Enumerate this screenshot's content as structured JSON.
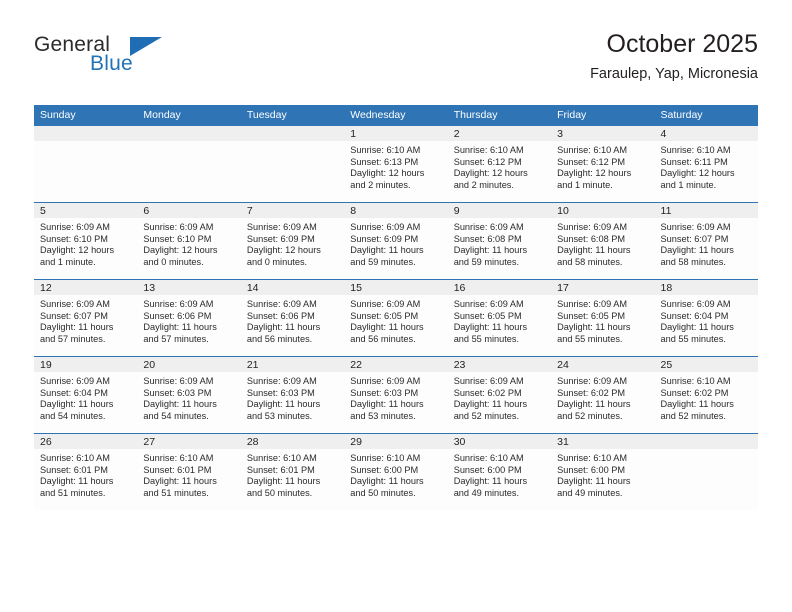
{
  "brand": {
    "line1": "General",
    "line2": "Blue",
    "triangle_color": "#1f6db5",
    "text_color": "#2b2b2b",
    "blue_color": "#2273b8"
  },
  "header": {
    "title": "October 2025",
    "subtitle": "Faraulep, Yap, Micronesia"
  },
  "theme": {
    "header_blue": "#2f74b5",
    "daynum_strip": "#efefef",
    "grid_line": "#2f74b5",
    "text": "#231f20"
  },
  "weekdays": [
    "Sunday",
    "Monday",
    "Tuesday",
    "Wednesday",
    "Thursday",
    "Friday",
    "Saturday"
  ],
  "weeks": [
    [
      {
        "day": "",
        "lines": []
      },
      {
        "day": "",
        "lines": []
      },
      {
        "day": "",
        "lines": []
      },
      {
        "day": "1",
        "lines": [
          "Sunrise: 6:10 AM",
          "Sunset: 6:13 PM",
          "Daylight: 12 hours",
          "and 2 minutes."
        ]
      },
      {
        "day": "2",
        "lines": [
          "Sunrise: 6:10 AM",
          "Sunset: 6:12 PM",
          "Daylight: 12 hours",
          "and 2 minutes."
        ]
      },
      {
        "day": "3",
        "lines": [
          "Sunrise: 6:10 AM",
          "Sunset: 6:12 PM",
          "Daylight: 12 hours",
          "and 1 minute."
        ]
      },
      {
        "day": "4",
        "lines": [
          "Sunrise: 6:10 AM",
          "Sunset: 6:11 PM",
          "Daylight: 12 hours",
          "and 1 minute."
        ]
      }
    ],
    [
      {
        "day": "5",
        "lines": [
          "Sunrise: 6:09 AM",
          "Sunset: 6:10 PM",
          "Daylight: 12 hours",
          "and 1 minute."
        ]
      },
      {
        "day": "6",
        "lines": [
          "Sunrise: 6:09 AM",
          "Sunset: 6:10 PM",
          "Daylight: 12 hours",
          "and 0 minutes."
        ]
      },
      {
        "day": "7",
        "lines": [
          "Sunrise: 6:09 AM",
          "Sunset: 6:09 PM",
          "Daylight: 12 hours",
          "and 0 minutes."
        ]
      },
      {
        "day": "8",
        "lines": [
          "Sunrise: 6:09 AM",
          "Sunset: 6:09 PM",
          "Daylight: 11 hours",
          "and 59 minutes."
        ]
      },
      {
        "day": "9",
        "lines": [
          "Sunrise: 6:09 AM",
          "Sunset: 6:08 PM",
          "Daylight: 11 hours",
          "and 59 minutes."
        ]
      },
      {
        "day": "10",
        "lines": [
          "Sunrise: 6:09 AM",
          "Sunset: 6:08 PM",
          "Daylight: 11 hours",
          "and 58 minutes."
        ]
      },
      {
        "day": "11",
        "lines": [
          "Sunrise: 6:09 AM",
          "Sunset: 6:07 PM",
          "Daylight: 11 hours",
          "and 58 minutes."
        ]
      }
    ],
    [
      {
        "day": "12",
        "lines": [
          "Sunrise: 6:09 AM",
          "Sunset: 6:07 PM",
          "Daylight: 11 hours",
          "and 57 minutes."
        ]
      },
      {
        "day": "13",
        "lines": [
          "Sunrise: 6:09 AM",
          "Sunset: 6:06 PM",
          "Daylight: 11 hours",
          "and 57 minutes."
        ]
      },
      {
        "day": "14",
        "lines": [
          "Sunrise: 6:09 AM",
          "Sunset: 6:06 PM",
          "Daylight: 11 hours",
          "and 56 minutes."
        ]
      },
      {
        "day": "15",
        "lines": [
          "Sunrise: 6:09 AM",
          "Sunset: 6:05 PM",
          "Daylight: 11 hours",
          "and 56 minutes."
        ]
      },
      {
        "day": "16",
        "lines": [
          "Sunrise: 6:09 AM",
          "Sunset: 6:05 PM",
          "Daylight: 11 hours",
          "and 55 minutes."
        ]
      },
      {
        "day": "17",
        "lines": [
          "Sunrise: 6:09 AM",
          "Sunset: 6:05 PM",
          "Daylight: 11 hours",
          "and 55 minutes."
        ]
      },
      {
        "day": "18",
        "lines": [
          "Sunrise: 6:09 AM",
          "Sunset: 6:04 PM",
          "Daylight: 11 hours",
          "and 55 minutes."
        ]
      }
    ],
    [
      {
        "day": "19",
        "lines": [
          "Sunrise: 6:09 AM",
          "Sunset: 6:04 PM",
          "Daylight: 11 hours",
          "and 54 minutes."
        ]
      },
      {
        "day": "20",
        "lines": [
          "Sunrise: 6:09 AM",
          "Sunset: 6:03 PM",
          "Daylight: 11 hours",
          "and 54 minutes."
        ]
      },
      {
        "day": "21",
        "lines": [
          "Sunrise: 6:09 AM",
          "Sunset: 6:03 PM",
          "Daylight: 11 hours",
          "and 53 minutes."
        ]
      },
      {
        "day": "22",
        "lines": [
          "Sunrise: 6:09 AM",
          "Sunset: 6:03 PM",
          "Daylight: 11 hours",
          "and 53 minutes."
        ]
      },
      {
        "day": "23",
        "lines": [
          "Sunrise: 6:09 AM",
          "Sunset: 6:02 PM",
          "Daylight: 11 hours",
          "and 52 minutes."
        ]
      },
      {
        "day": "24",
        "lines": [
          "Sunrise: 6:09 AM",
          "Sunset: 6:02 PM",
          "Daylight: 11 hours",
          "and 52 minutes."
        ]
      },
      {
        "day": "25",
        "lines": [
          "Sunrise: 6:10 AM",
          "Sunset: 6:02 PM",
          "Daylight: 11 hours",
          "and 52 minutes."
        ]
      }
    ],
    [
      {
        "day": "26",
        "lines": [
          "Sunrise: 6:10 AM",
          "Sunset: 6:01 PM",
          "Daylight: 11 hours",
          "and 51 minutes."
        ]
      },
      {
        "day": "27",
        "lines": [
          "Sunrise: 6:10 AM",
          "Sunset: 6:01 PM",
          "Daylight: 11 hours",
          "and 51 minutes."
        ]
      },
      {
        "day": "28",
        "lines": [
          "Sunrise: 6:10 AM",
          "Sunset: 6:01 PM",
          "Daylight: 11 hours",
          "and 50 minutes."
        ]
      },
      {
        "day": "29",
        "lines": [
          "Sunrise: 6:10 AM",
          "Sunset: 6:00 PM",
          "Daylight: 11 hours",
          "and 50 minutes."
        ]
      },
      {
        "day": "30",
        "lines": [
          "Sunrise: 6:10 AM",
          "Sunset: 6:00 PM",
          "Daylight: 11 hours",
          "and 49 minutes."
        ]
      },
      {
        "day": "31",
        "lines": [
          "Sunrise: 6:10 AM",
          "Sunset: 6:00 PM",
          "Daylight: 11 hours",
          "and 49 minutes."
        ]
      },
      {
        "day": "",
        "lines": []
      }
    ]
  ]
}
